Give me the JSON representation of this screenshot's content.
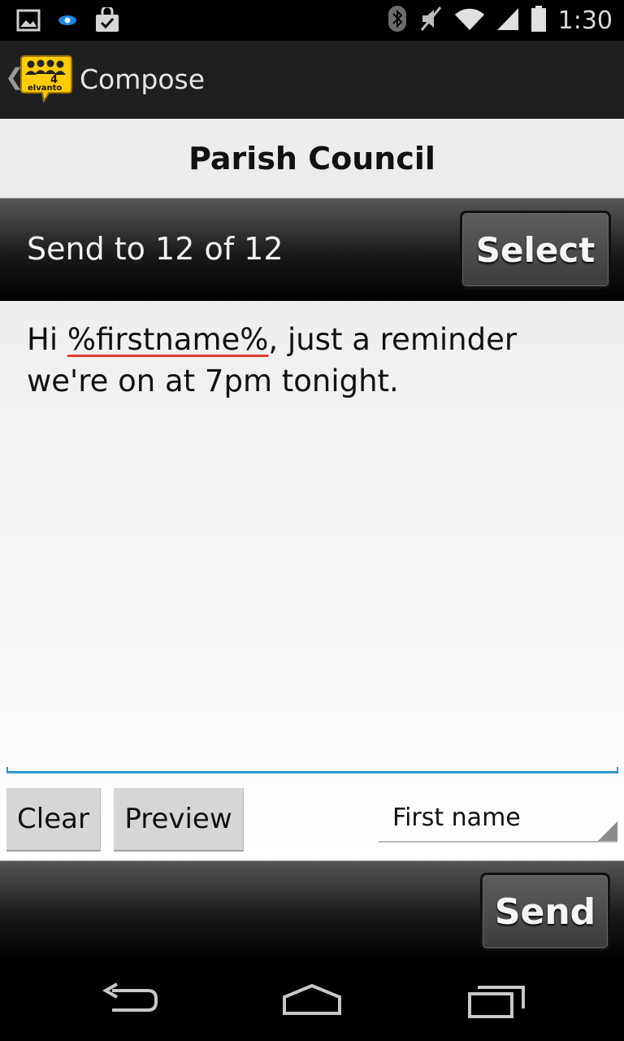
{
  "status_bar": {
    "left_icons": [
      "image-icon",
      "eye-icon",
      "bag-check-icon"
    ],
    "right_icons": [
      "bluetooth-icon",
      "mute-icon",
      "wifi-icon",
      "signal-icon",
      "battery-icon"
    ],
    "time": "1:30"
  },
  "action_bar": {
    "logo_number": "4",
    "logo_text": "elvanto",
    "title": "Compose"
  },
  "group": {
    "title": "Parish Council"
  },
  "recipients": {
    "text": "Send to 12 of 12",
    "select_label": "Select"
  },
  "message": {
    "before": "Hi ",
    "placeholder_token": "%firstname%",
    "after": ", just a reminder we're on at 7pm tonight."
  },
  "tools": {
    "clear_label": "Clear",
    "preview_label": "Preview",
    "field_selected": "First name"
  },
  "send": {
    "label": "Send"
  },
  "nav": {
    "icons": [
      "back-icon",
      "home-icon",
      "recent-apps-icon"
    ]
  },
  "colors": {
    "accent_underline": "#2a9ad6",
    "spellcheck": "#e53935",
    "logo_yellow": "#ffcc00"
  }
}
